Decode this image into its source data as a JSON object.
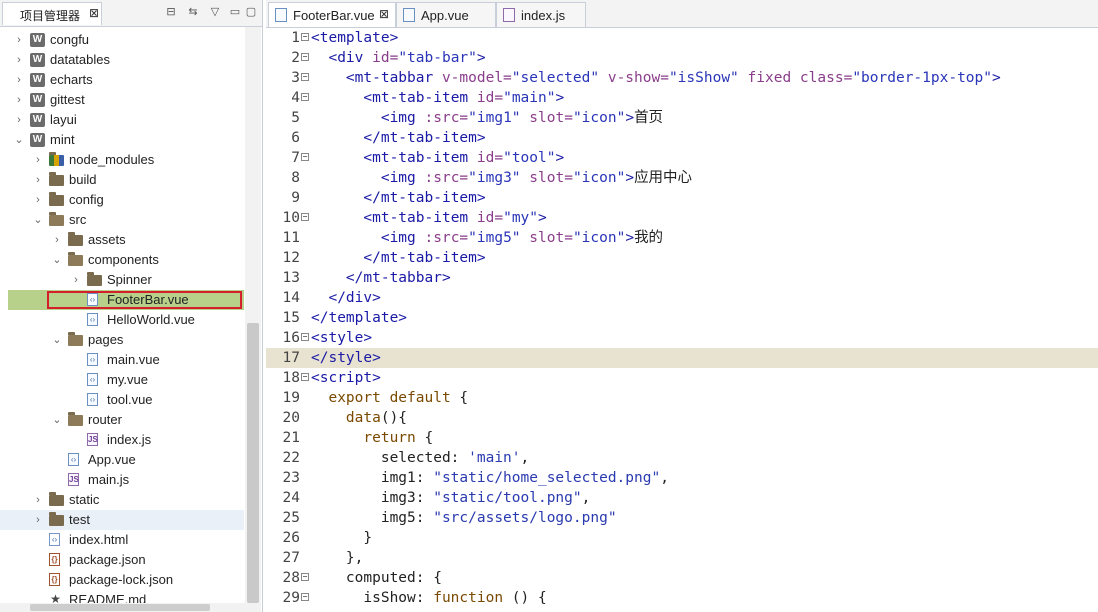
{
  "left_panel": {
    "title": "项目管理器",
    "close": "⊠",
    "toolbar": {
      "collapse": "⊟",
      "link": "⇆",
      "menu": "▽",
      "minimize": "▭",
      "maximize": "▢"
    }
  },
  "tree": [
    {
      "label": "congfu",
      "type": "project",
      "depth": 0,
      "arrow": "›"
    },
    {
      "label": "datatables",
      "type": "project",
      "depth": 0,
      "arrow": "›"
    },
    {
      "label": "echarts",
      "type": "project",
      "depth": 0,
      "arrow": "›"
    },
    {
      "label": "gittest",
      "type": "project",
      "depth": 0,
      "arrow": "›"
    },
    {
      "label": "layui",
      "type": "project",
      "depth": 0,
      "arrow": "›"
    },
    {
      "label": "mint",
      "type": "project",
      "depth": 0,
      "arrow": "⌄"
    },
    {
      "label": "node_modules",
      "type": "nodemodules",
      "depth": 1,
      "arrow": "›"
    },
    {
      "label": "build",
      "type": "folder",
      "depth": 1,
      "arrow": "›"
    },
    {
      "label": "config",
      "type": "folder",
      "depth": 1,
      "arrow": "›"
    },
    {
      "label": "src",
      "type": "folder-open",
      "depth": 1,
      "arrow": "⌄"
    },
    {
      "label": "assets",
      "type": "folder",
      "depth": 2,
      "arrow": "›"
    },
    {
      "label": "components",
      "type": "folder-open",
      "depth": 2,
      "arrow": "⌄"
    },
    {
      "label": "Spinner",
      "type": "folder",
      "depth": 3,
      "arrow": "›"
    },
    {
      "label": "FooterBar.vue",
      "type": "vue",
      "depth": 3,
      "arrow": "",
      "selected": true
    },
    {
      "label": "HelloWorld.vue",
      "type": "vue",
      "depth": 3,
      "arrow": ""
    },
    {
      "label": "pages",
      "type": "folder-open",
      "depth": 2,
      "arrow": "⌄"
    },
    {
      "label": "main.vue",
      "type": "vue",
      "depth": 3,
      "arrow": ""
    },
    {
      "label": "my.vue",
      "type": "vue",
      "depth": 3,
      "arrow": ""
    },
    {
      "label": "tool.vue",
      "type": "vue",
      "depth": 3,
      "arrow": ""
    },
    {
      "label": "router",
      "type": "folder-open",
      "depth": 2,
      "arrow": "⌄"
    },
    {
      "label": "index.js",
      "type": "js",
      "depth": 3,
      "arrow": ""
    },
    {
      "label": "App.vue",
      "type": "vue",
      "depth": 2,
      "arrow": ""
    },
    {
      "label": "main.js",
      "type": "js",
      "depth": 2,
      "arrow": ""
    },
    {
      "label": "static",
      "type": "folder",
      "depth": 1,
      "arrow": "›"
    },
    {
      "label": "test",
      "type": "folder",
      "depth": 1,
      "arrow": "›",
      "hover": true
    },
    {
      "label": "index.html",
      "type": "html",
      "depth": 1,
      "arrow": ""
    },
    {
      "label": "package.json",
      "type": "json",
      "depth": 1,
      "arrow": ""
    },
    {
      "label": "package-lock.json",
      "type": "json",
      "depth": 1,
      "arrow": ""
    },
    {
      "label": "README.md",
      "type": "readme",
      "depth": 1,
      "arrow": ""
    }
  ],
  "editor": {
    "tabs": [
      {
        "label": "FooterBar.vue",
        "icon": "vue",
        "active": true,
        "close": "⊠"
      },
      {
        "label": "App.vue",
        "icon": "vue",
        "active": false,
        "close": ""
      },
      {
        "label": "index.js",
        "icon": "js",
        "active": false,
        "close": ""
      }
    ],
    "current_line": 17,
    "lines": [
      {
        "n": "1",
        "fold": "−",
        "segs": [
          [
            "t",
            "<template>"
          ]
        ]
      },
      {
        "n": "2",
        "fold": "−",
        "segs": [
          [
            "p",
            "  "
          ],
          [
            "t",
            "<div "
          ],
          [
            "a",
            "id="
          ],
          [
            "s",
            "\"tab-bar\""
          ],
          [
            "t",
            ">"
          ]
        ]
      },
      {
        "n": "3",
        "fold": "−",
        "segs": [
          [
            "p",
            "    "
          ],
          [
            "t",
            "<mt-tabbar "
          ],
          [
            "a",
            "v-model="
          ],
          [
            "s",
            "\"selected\""
          ],
          [
            "p",
            " "
          ],
          [
            "a",
            "v-show="
          ],
          [
            "s",
            "\"isShow\""
          ],
          [
            "p",
            " "
          ],
          [
            "a",
            "fixed "
          ],
          [
            "a",
            "class="
          ],
          [
            "s",
            "\"border-1px-top\""
          ],
          [
            "t",
            ">"
          ]
        ]
      },
      {
        "n": "4",
        "fold": "−",
        "segs": [
          [
            "p",
            "      "
          ],
          [
            "t",
            "<mt-tab-item "
          ],
          [
            "a",
            "id="
          ],
          [
            "s",
            "\"main\""
          ],
          [
            "t",
            ">"
          ]
        ]
      },
      {
        "n": "5",
        "fold": "",
        "segs": [
          [
            "p",
            "        "
          ],
          [
            "t",
            "<img "
          ],
          [
            "a",
            ":src="
          ],
          [
            "s",
            "\"img1\""
          ],
          [
            "p",
            " "
          ],
          [
            "a",
            "slot="
          ],
          [
            "s",
            "\"icon\""
          ],
          [
            "t",
            ">"
          ],
          [
            "cjk",
            "首页"
          ]
        ]
      },
      {
        "n": "6",
        "fold": "",
        "segs": [
          [
            "p",
            "      "
          ],
          [
            "t",
            "</mt-tab-item>"
          ]
        ]
      },
      {
        "n": "7",
        "fold": "−",
        "segs": [
          [
            "p",
            "      "
          ],
          [
            "t",
            "<mt-tab-item "
          ],
          [
            "a",
            "id="
          ],
          [
            "s",
            "\"tool\""
          ],
          [
            "t",
            ">"
          ]
        ]
      },
      {
        "n": "8",
        "fold": "",
        "segs": [
          [
            "p",
            "        "
          ],
          [
            "t",
            "<img "
          ],
          [
            "a",
            ":src="
          ],
          [
            "s",
            "\"img3\""
          ],
          [
            "p",
            " "
          ],
          [
            "a",
            "slot="
          ],
          [
            "s",
            "\"icon\""
          ],
          [
            "t",
            ">"
          ],
          [
            "cjk",
            "应用中心"
          ]
        ]
      },
      {
        "n": "9",
        "fold": "",
        "segs": [
          [
            "p",
            "      "
          ],
          [
            "t",
            "</mt-tab-item>"
          ]
        ]
      },
      {
        "n": "10",
        "fold": "−",
        "segs": [
          [
            "p",
            "      "
          ],
          [
            "t",
            "<mt-tab-item "
          ],
          [
            "a",
            "id="
          ],
          [
            "s",
            "\"my\""
          ],
          [
            "t",
            ">"
          ]
        ]
      },
      {
        "n": "11",
        "fold": "",
        "segs": [
          [
            "p",
            "        "
          ],
          [
            "t",
            "<img "
          ],
          [
            "a",
            ":src="
          ],
          [
            "s",
            "\"img5\""
          ],
          [
            "p",
            " "
          ],
          [
            "a",
            "slot="
          ],
          [
            "s",
            "\"icon\""
          ],
          [
            "t",
            ">"
          ],
          [
            "cjk",
            "我的"
          ]
        ]
      },
      {
        "n": "12",
        "fold": "",
        "segs": [
          [
            "p",
            "      "
          ],
          [
            "t",
            "</mt-tab-item>"
          ]
        ]
      },
      {
        "n": "13",
        "fold": "",
        "segs": [
          [
            "p",
            "    "
          ],
          [
            "t",
            "</mt-tabbar>"
          ]
        ]
      },
      {
        "n": "14",
        "fold": "",
        "segs": [
          [
            "p",
            "  "
          ],
          [
            "t",
            "</div>"
          ]
        ]
      },
      {
        "n": "15",
        "fold": "",
        "segs": [
          [
            "t",
            "</template>"
          ]
        ]
      },
      {
        "n": "16",
        "fold": "−",
        "segs": [
          [
            "t",
            "<style>"
          ]
        ]
      },
      {
        "n": "17",
        "fold": "",
        "segs": [
          [
            "t",
            "</style>"
          ]
        ]
      },
      {
        "n": "18",
        "fold": "−",
        "segs": [
          [
            "t",
            "<script>"
          ]
        ]
      },
      {
        "n": "19",
        "fold": "",
        "segs": [
          [
            "p",
            "  "
          ],
          [
            "k",
            "export default"
          ],
          [
            "p",
            " {"
          ]
        ]
      },
      {
        "n": "20",
        "fold": "",
        "segs": [
          [
            "p",
            "    "
          ],
          [
            "k",
            "data"
          ],
          [
            "p",
            "(){"
          ]
        ]
      },
      {
        "n": "21",
        "fold": "",
        "segs": [
          [
            "p",
            "      "
          ],
          [
            "k",
            "return"
          ],
          [
            "p",
            " {"
          ]
        ]
      },
      {
        "n": "22",
        "fold": "",
        "segs": [
          [
            "p",
            "        selected: "
          ],
          [
            "str",
            "'main'"
          ],
          [
            "p",
            ","
          ]
        ]
      },
      {
        "n": "23",
        "fold": "",
        "segs": [
          [
            "p",
            "        img1: "
          ],
          [
            "str",
            "\"static/home_selected.png\""
          ],
          [
            "p",
            ","
          ]
        ]
      },
      {
        "n": "24",
        "fold": "",
        "segs": [
          [
            "p",
            "        img3: "
          ],
          [
            "str",
            "\"static/tool.png\""
          ],
          [
            "p",
            ","
          ]
        ]
      },
      {
        "n": "25",
        "fold": "",
        "segs": [
          [
            "p",
            "        img5: "
          ],
          [
            "str",
            "\"src/assets/logo.png\""
          ]
        ]
      },
      {
        "n": "26",
        "fold": "",
        "segs": [
          [
            "p",
            "      }"
          ]
        ]
      },
      {
        "n": "27",
        "fold": "",
        "segs": [
          [
            "p",
            "    },"
          ]
        ]
      },
      {
        "n": "28",
        "fold": "−",
        "segs": [
          [
            "p",
            "    computed: {"
          ]
        ]
      },
      {
        "n": "29",
        "fold": "−",
        "segs": [
          [
            "p",
            "      isShow: "
          ],
          [
            "k",
            "function"
          ],
          [
            "p",
            " () {"
          ]
        ]
      }
    ]
  }
}
